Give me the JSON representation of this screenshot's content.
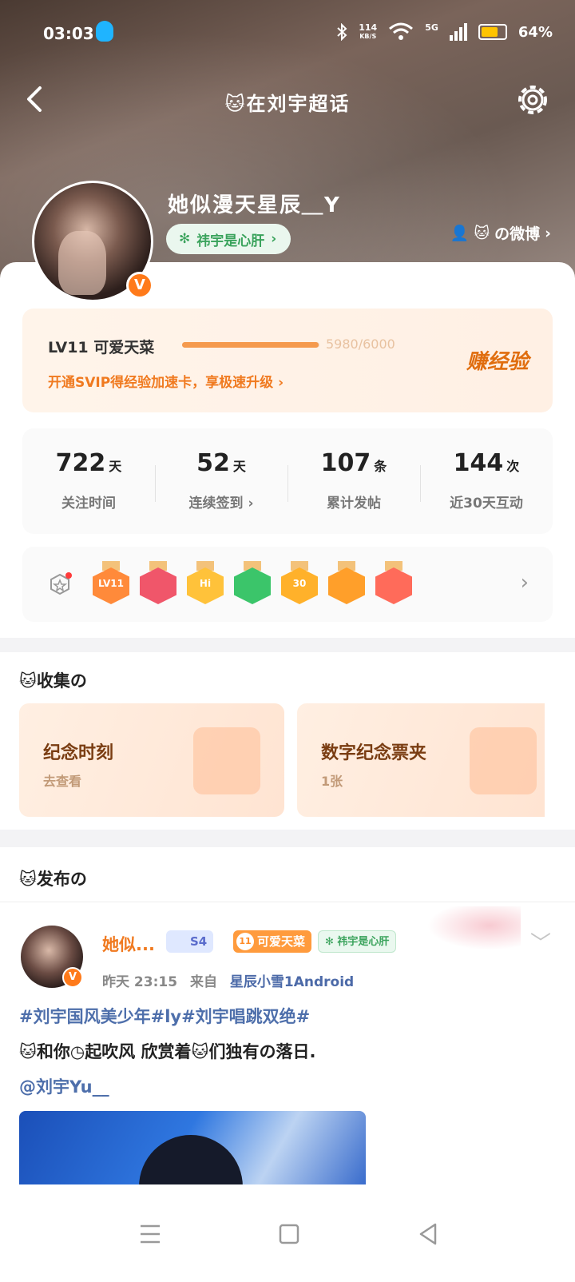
{
  "status_bar": {
    "time": "03:03",
    "net_speed_value": "114",
    "net_speed_unit": "KB/S",
    "network": "5G",
    "battery": "64%"
  },
  "nav": {
    "title": "在刘宇超话"
  },
  "profile": {
    "username": "她似漫天星辰＿Y",
    "fan_tag": "祎宇是心肝",
    "weibo_link": "の微博",
    "verified_mark": "V"
  },
  "level": {
    "title": "LV11  可爱天菜",
    "progress_text": "5980/6000",
    "progress_fraction": 0.9967,
    "svip_text": "开通SVIP得经验加速卡，享极速升级",
    "earn_label": "赚经验"
  },
  "stats": [
    {
      "value": "722",
      "unit": "天",
      "label": "关注时间"
    },
    {
      "value": "52",
      "unit": "天",
      "label": "连续签到"
    },
    {
      "value": "107",
      "unit": "条",
      "label": "累计发帖"
    },
    {
      "value": "144",
      "unit": "次",
      "label": "近30天互动"
    }
  ],
  "medals": [
    {
      "text": "LV11",
      "color": "#ff8a3a"
    },
    {
      "text": "",
      "color": "#f0566a"
    },
    {
      "text": "Hi",
      "color": "#ffc23a"
    },
    {
      "text": "",
      "color": "#3bc56a"
    },
    {
      "text": "30",
      "color": "#ffb12a"
    },
    {
      "text": "",
      "color": "#ff9f2a"
    },
    {
      "text": "",
      "color": "#ff6b5a"
    }
  ],
  "collect": {
    "title": "收集の",
    "cards": [
      {
        "title": "纪念时刻",
        "sub": "去查看"
      },
      {
        "title": "数字纪念票夹",
        "sub": "1张"
      }
    ]
  },
  "publish": {
    "title": "发布の",
    "post": {
      "name": "她似...",
      "badge_s4": "S4",
      "badge_level": "可爱天菜",
      "badge_fan": "祎宇是心肝",
      "time": "昨天  23:15",
      "from_label": "来自",
      "source": "星辰小雪1Android",
      "topics": "#刘宇国风美少年#ly#刘宇唱跳双绝#",
      "text": "和你◷起吹风 欣赏着",
      "text_tail": "们独有の落日.",
      "mention": "@刘宇Yu__"
    }
  },
  "colors": {
    "accent_orange": "#f07a20",
    "link_blue": "#4e6fab",
    "green_tag": "#3aa35c"
  }
}
